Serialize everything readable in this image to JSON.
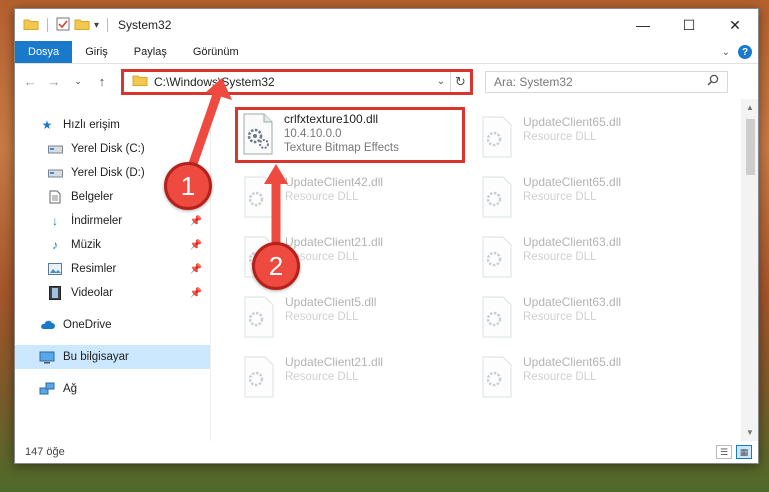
{
  "window": {
    "title": "System32",
    "controls": {
      "minimize": "—",
      "maximize": "☐",
      "close": "✕"
    }
  },
  "ribbon": {
    "tabs": [
      {
        "label": "Dosya",
        "active": true
      },
      {
        "label": "Giriş"
      },
      {
        "label": "Paylaş"
      },
      {
        "label": "Görünüm"
      }
    ]
  },
  "address": {
    "path": "C:\\Windows\\System32",
    "search_placeholder": "Ara: System32"
  },
  "sidebar": {
    "items": [
      {
        "label": "Hızlı erişim",
        "icon": "star-icon"
      },
      {
        "label": "Yerel Disk (C:)",
        "icon": "drive-icon"
      },
      {
        "label": "Yerel Disk (D:)",
        "icon": "drive-icon"
      },
      {
        "label": "Belgeler",
        "icon": "documents-icon"
      },
      {
        "label": "İndirmeler",
        "icon": "download-icon",
        "pinned": true
      },
      {
        "label": "Müzik",
        "icon": "music-icon",
        "pinned": true
      },
      {
        "label": "Resimler",
        "icon": "pictures-icon",
        "pinned": true
      },
      {
        "label": "Videolar",
        "icon": "videos-icon",
        "pinned": true
      },
      {
        "label": "OneDrive",
        "icon": "cloud-icon"
      },
      {
        "label": "Bu bilgisayar",
        "icon": "computer-icon",
        "selected": true
      },
      {
        "label": "Ağ",
        "icon": "network-icon"
      }
    ]
  },
  "files": {
    "highlighted": {
      "name": "crlfxtexture100.dll",
      "version": "10.4.10.0.0",
      "description": "Texture Bitmap Effects"
    },
    "faded": [
      {
        "name": "UpdateClient42.dll",
        "type": "Resource DLL"
      },
      {
        "name": "UpdateClient21.dll",
        "type": "Resource DLL"
      },
      {
        "name": "UpdateClient5.dll",
        "type": "Resource DLL"
      },
      {
        "name": "UpdateClient21.dll",
        "type": "Resource DLL"
      },
      {
        "name": "UpdateClient65.dll",
        "type": "Resource DLL"
      },
      {
        "name": "UpdateClient65.dll",
        "type": "Resource DLL"
      },
      {
        "name": "UpdateClient63.dll",
        "type": "Resource DLL"
      },
      {
        "name": "UpdateClient63.dll",
        "type": "Resource DLL"
      },
      {
        "name": "UpdateClient65.dll",
        "type": "Resource DLL"
      }
    ]
  },
  "status": {
    "item_count": "147 öğe"
  },
  "callouts": {
    "one": "1",
    "two": "2"
  },
  "colors": {
    "accent": "#1979ca",
    "highlight": "#d9352f",
    "callout": "#ee4a3f"
  }
}
